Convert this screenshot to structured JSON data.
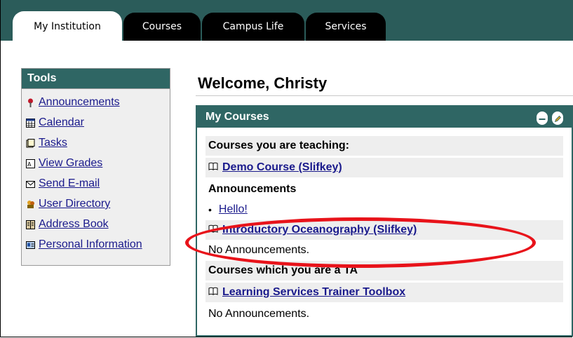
{
  "tabs": [
    {
      "label": "My Institution",
      "active": true
    },
    {
      "label": "Courses",
      "active": false
    },
    {
      "label": "Campus Life",
      "active": false
    },
    {
      "label": "Services",
      "active": false
    }
  ],
  "tools": {
    "title": "Tools",
    "items": [
      {
        "label": "Announcements",
        "icon": "pushpin-icon"
      },
      {
        "label": "Calendar",
        "icon": "calendar-icon"
      },
      {
        "label": "Tasks",
        "icon": "tasks-icon"
      },
      {
        "label": "View Grades",
        "icon": "grades-icon"
      },
      {
        "label": "Send E-mail",
        "icon": "envelope-icon"
      },
      {
        "label": "User Directory",
        "icon": "users-icon"
      },
      {
        "label": "Address Book",
        "icon": "address-book-icon"
      },
      {
        "label": "Personal Information",
        "icon": "id-card-icon"
      }
    ]
  },
  "welcome": "Welcome, Christy",
  "my_courses": {
    "title": "My Courses",
    "teaching_heading": "Courses you are teaching:",
    "course1": "Demo Course (Slifkey)",
    "announcements_heading": "Announcements",
    "announcement1": "Hello!",
    "course2": "Introductory Oceanography (Slifkey)",
    "no_announcements_1": "No Announcements.",
    "ta_heading": "Courses which you are a TA",
    "course3": "Learning Services Trainer Toolbox",
    "no_announcements_2": "No Announcements."
  },
  "colors": {
    "tab_bar": "#2b5c5a",
    "header_teal": "#2f6664",
    "highlight_ellipse": "#e8131a",
    "link": "#1a1a8c"
  }
}
